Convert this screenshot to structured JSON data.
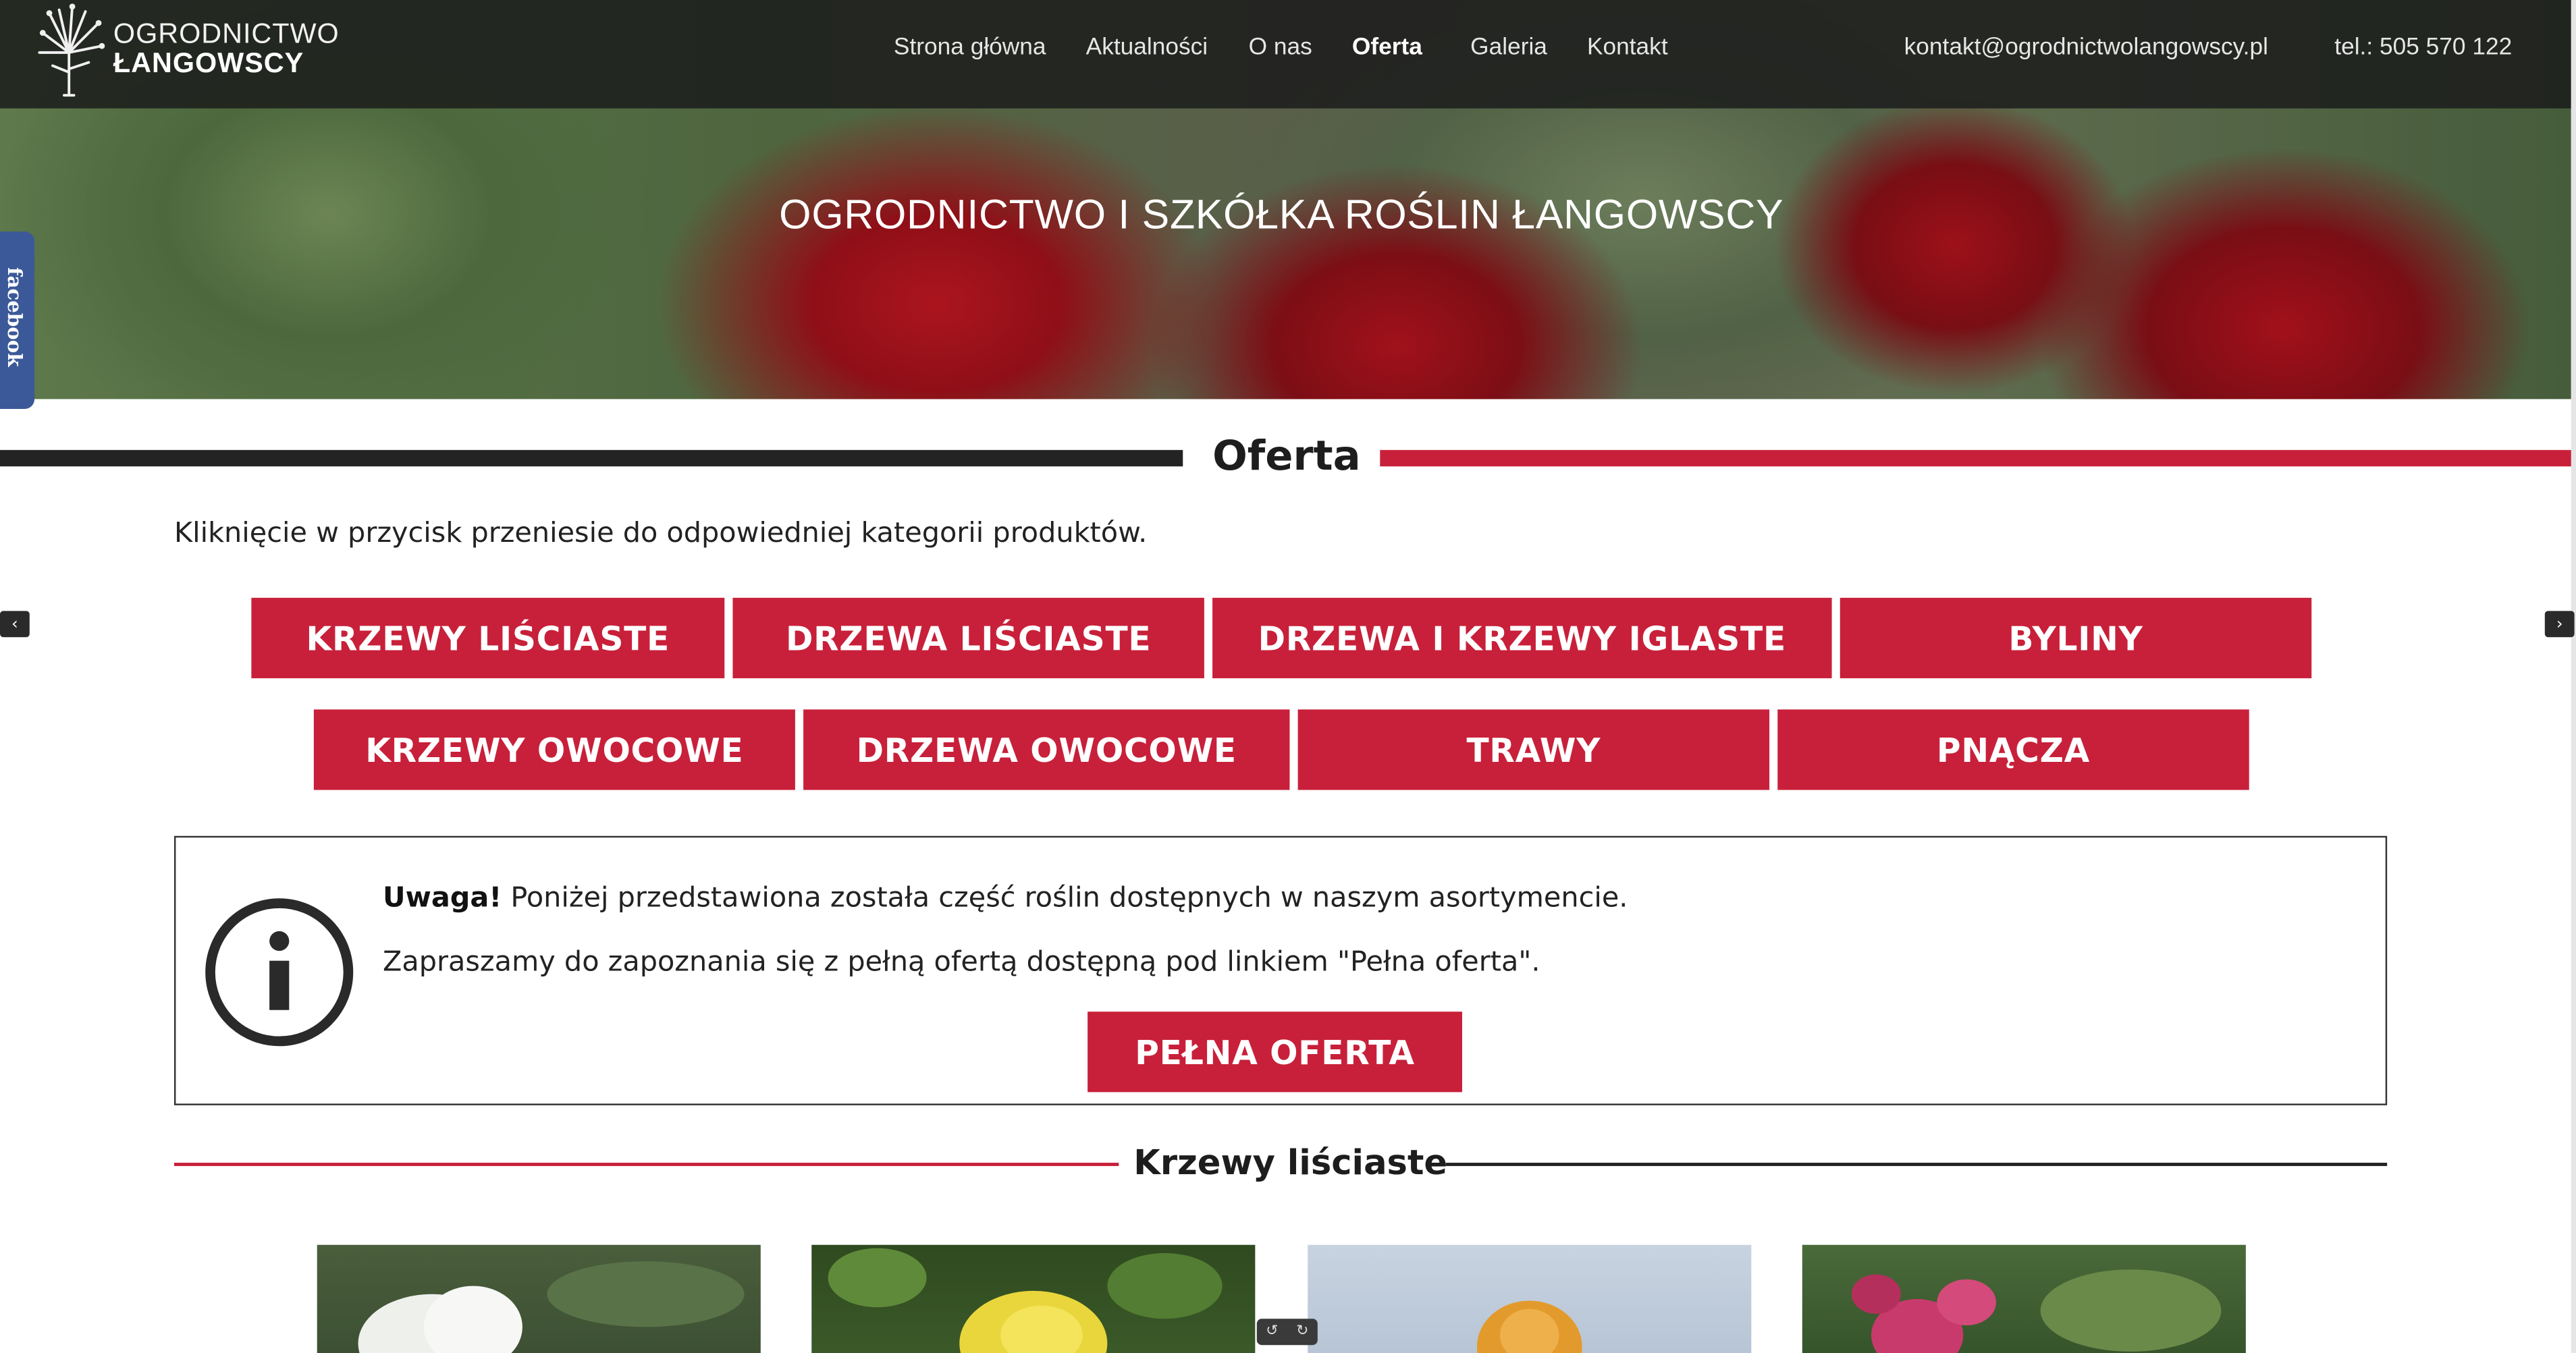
{
  "header": {
    "logo_line1": "OGRODNICTWO",
    "logo_line2": "ŁANGOWSCY",
    "nav": [
      "Strona główna",
      "Aktualności",
      "O nas",
      "Oferta",
      "Galeria",
      "Kontakt"
    ],
    "active_nav": "Oferta",
    "email": "kontakt@ogrodnictwolangowscy.pl",
    "phone": "tel.: 505 570 122"
  },
  "hero": {
    "title": "OGRODNICTWO I SZKÓŁKA ROŚLIN ŁANGOWSCY"
  },
  "facebook_tab": {
    "label": "facebook",
    "color": "#3b5998"
  },
  "offer": {
    "title": "Oferta",
    "intro": "Kliknięcie w przycisk przeniesie do odpowiedniej kategorii produktów.",
    "categories_row1": [
      "KRZEWY LIŚCIASTE",
      "DRZEWA LIŚCIASTE",
      "DRZEWA I KRZEWY IGLASTE",
      "BYLINY"
    ],
    "categories_row2": [
      "KRZEWY OWOCOWE",
      "DRZEWA OWOCOWE",
      "TRAWY",
      "PNĄCZA"
    ]
  },
  "notice": {
    "bold": "Uwaga!",
    "line1_rest": " Poniżej przedstawiona została część roślin dostępnych w naszym asortymencie.",
    "line2": "Zapraszamy do zapoznania się z pełną ofertą dostępną pod linkiem \"Pełna oferta\".",
    "button": "PEŁNA OFERTA"
  },
  "section2": {
    "title": "Krzewy liściaste"
  },
  "slider_arrows": {
    "left": "‹",
    "right": "›"
  },
  "colors": {
    "accent": "#c8203a",
    "dark": "#232323",
    "topbar": "#1c1e1c"
  },
  "icons": [
    "info-icon",
    "logo-plant-icon",
    "chevron-left-icon",
    "chevron-right-icon",
    "pause-icon"
  ]
}
